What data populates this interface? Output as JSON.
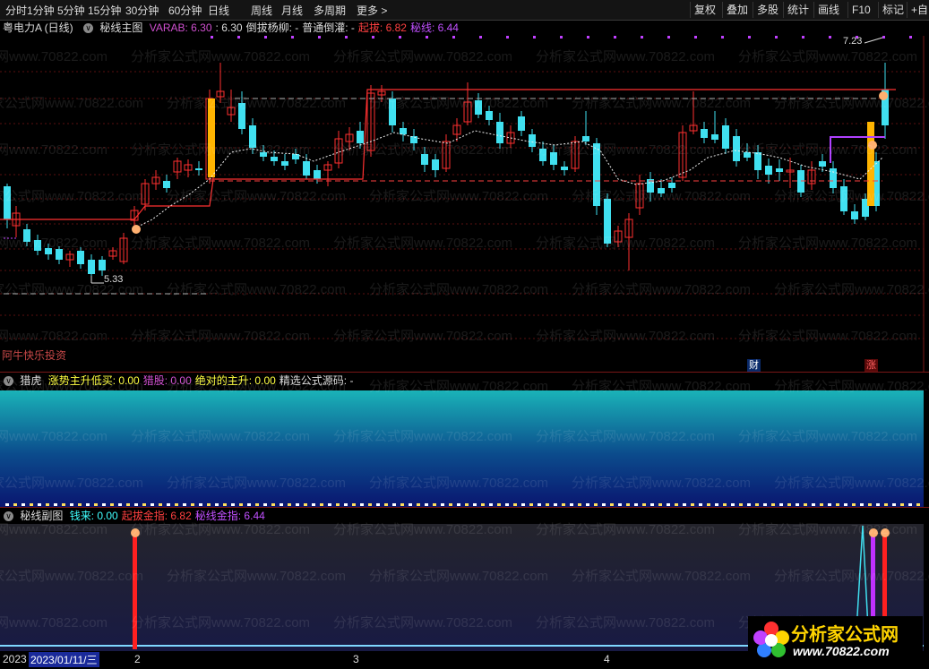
{
  "toolbar": {
    "timeframes": [
      "分时",
      "1分钟",
      "5分钟",
      "15分钟",
      "30分钟",
      "60分钟",
      "日线",
      "周线",
      "月线",
      "多周期",
      "更多 >"
    ],
    "right_buttons": [
      "复权",
      "叠加",
      "多股",
      "统计",
      "画线",
      "F10",
      "标记",
      "+自"
    ]
  },
  "main": {
    "stock": "粤电力A (日线)",
    "indicator": "秘线主图",
    "items": [
      {
        "label": "VARAB: 6.30",
        "color": "#d050d0"
      },
      {
        "label": ": 6.30",
        "color": "#dddddd"
      },
      {
        "label": "倒拔杨柳: -",
        "color": "#dddddd"
      },
      {
        "label": "普通倒灌: -",
        "color": "#dddddd"
      },
      {
        "label": "起拔: 6.82",
        "color": "#ff4040"
      },
      {
        "label": "秘线: 6.44",
        "color": "#c050ff"
      }
    ],
    "price_high_label": "7.23",
    "price_low_label": "5.33",
    "left_caption": "阿牛快乐投资",
    "badge_cai": "财",
    "badge_zhang": "涨"
  },
  "panel2": {
    "indicator": "猎虎",
    "items": [
      {
        "label": "涨势主升低买: 0.00",
        "color": "#ffff40"
      },
      {
        "label": "猎股: 0.00",
        "color": "#d050d0"
      },
      {
        "label": "绝对的主升: 0.00",
        "color": "#ffff40"
      },
      {
        "label": "精选公式源码: -",
        "color": "#dddddd"
      }
    ]
  },
  "panel3": {
    "indicator": "秘线副图",
    "items": [
      {
        "label": "钱来: 0.00",
        "color": "#40ffff"
      },
      {
        "label": "起拔金指: 6.82",
        "color": "#ff4040"
      },
      {
        "label": "秘线金指: 6.44",
        "color": "#c050ff"
      }
    ]
  },
  "dates": {
    "first": "2023",
    "selected": "2023/01/11/三",
    "m2": "2",
    "m3": "3",
    "m4": "4"
  },
  "watermark": {
    "text": "分析家公式网www.70822.com"
  },
  "brand": {
    "name": "分析家公式网",
    "url": "www.70822.com"
  },
  "colors": {
    "up": "#ff3030",
    "down": "#40e0f0",
    "accent_purple": "#c050ff",
    "gold": "#ffb400"
  }
}
